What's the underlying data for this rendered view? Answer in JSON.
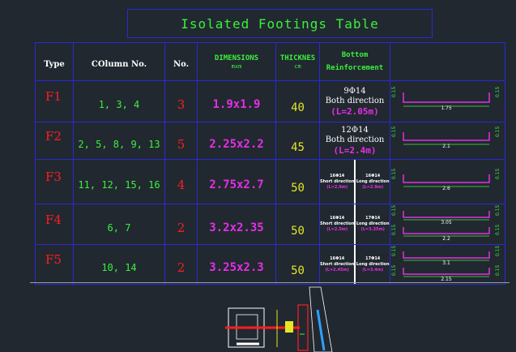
{
  "title": "Isolated Footings Table",
  "headers": {
    "type": "Type",
    "column_no": "COlumn No.",
    "no": "No.",
    "dimensions": "DIMENSIONS",
    "dimensions_unit": "mxm",
    "thickness": "THICKNES",
    "thickness_unit": "cm",
    "bottom_reinf_1": "Bottom",
    "bottom_reinf_2": "Reinforcement"
  },
  "rows": [
    {
      "type": "F1",
      "columns": "1, 3, 4",
      "no": "3",
      "dimensions": "1.9x1.9",
      "thickness": "40",
      "reinf_bars": "9Φ14",
      "reinf_dir": "Both direction",
      "reinf_len": "(L=2.05m)",
      "hook_left": "0.15",
      "hook_right": "0.15",
      "bar_len": "1.75"
    },
    {
      "type": "F2",
      "columns": "2, 5, 8, 9, 13",
      "no": "5",
      "dimensions": "2.25x2.2",
      "thickness": "45",
      "reinf_bars": "12Φ14",
      "reinf_dir": "Both direction",
      "reinf_len": "(L=2.4m)",
      "hook_left": "0.15",
      "hook_right": "0.15",
      "bar_len": "2.1"
    },
    {
      "type": "F3",
      "columns": "11, 12, 15, 16",
      "no": "4",
      "dimensions": "2.75x2.7",
      "thickness": "50",
      "short_bars": "16Φ14",
      "short_dir": "Short direction",
      "short_len": "(L=2.9m)",
      "long_bars": "16Φ14",
      "long_dir": "Long direction",
      "long_len": "(L=2.9m)",
      "hook_left": "0.15",
      "hook_right": "0.15",
      "bar_len": "2.6"
    },
    {
      "type": "F4",
      "columns": "6, 7",
      "no": "2",
      "dimensions": "3.2x2.35",
      "thickness": "50",
      "short_bars": "16Φ14",
      "short_dir": "Short direction",
      "short_len": "(L=2.5m)",
      "long_bars": "17Φ14",
      "long_dir": "Long direction",
      "long_len": "(L=3.35m)",
      "hook_left": "0.15",
      "hook_right": "0.15",
      "bar_len_top": "3.05",
      "bar_len_bottom": "2.2"
    },
    {
      "type": "F5",
      "columns": "10, 14",
      "no": "2",
      "dimensions": "3.25x2.3",
      "thickness": "50",
      "short_bars": "16Φ14",
      "short_dir": "Short direction",
      "short_len": "(L=2.45m)",
      "long_bars": "17Φ14",
      "long_dir": "Long direction",
      "long_len": "(L=3.4m)",
      "hook_left": "0.15",
      "hook_right": "0.15",
      "bar_len_top": "3.1",
      "bar_len_bottom": "2.15"
    }
  ],
  "colors": {
    "background": "#212830",
    "grid": "#2a2ad4",
    "green": "#3cf03c",
    "red": "#ff1e1e",
    "magenta": "#e62ee6",
    "yellow": "#e6e626",
    "white": "#ffffff"
  }
}
